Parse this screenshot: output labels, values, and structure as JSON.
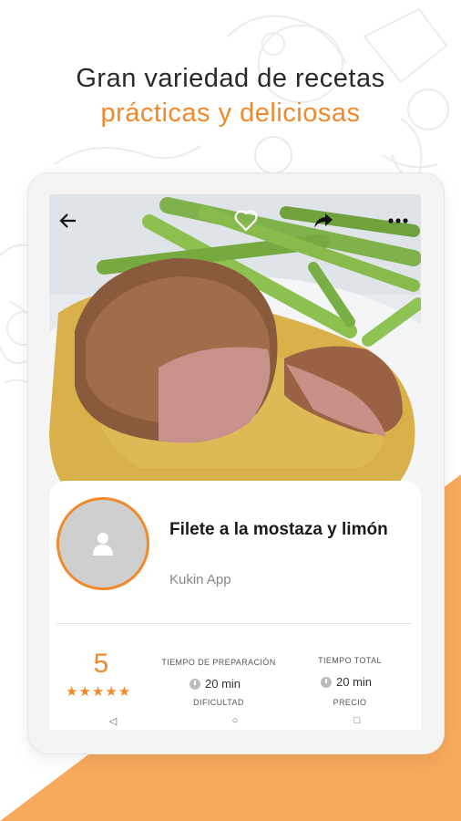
{
  "headline": {
    "line1": "Gran variedad de recetas",
    "line2": "prácticas y deliciosas"
  },
  "colors": {
    "accent": "#f0892a",
    "wedge": "#f7a95c"
  },
  "topbar": {
    "back_icon": "arrow-left-icon",
    "favorite_icon": "heart-outline-icon",
    "share_icon": "share-icon",
    "more_icon": "more-dots-icon"
  },
  "recipe": {
    "title": "Filete a la mostaza y limón",
    "author": "Kukin App",
    "rating": "5",
    "stars": "★★★★★",
    "rating_fraction": 1.0
  },
  "stats": {
    "prep_label": "TIEMPO DE PREPARACIÓN",
    "prep_value": "20 min",
    "total_label": "TIEMPO TOTAL",
    "total_value": "20 min",
    "difficulty_label": "DIFICULTAD",
    "price_label": "PRECIO"
  },
  "navbar": {
    "back": "◁",
    "home": "○",
    "recent": "□"
  }
}
